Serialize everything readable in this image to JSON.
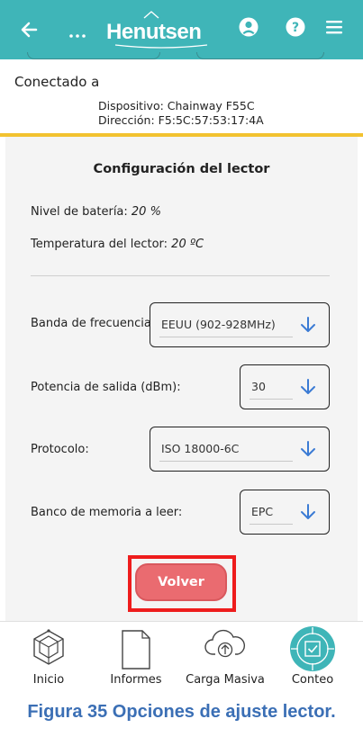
{
  "header": {
    "logo_text": "Henutsen",
    "back_icon": "arrow-left-icon",
    "more_icon": "ellipsis-icon",
    "user_icon": "user-circle-icon",
    "help_icon": "question-circle-icon",
    "menu_icon": "hamburger-menu-icon",
    "color": "#3fb5b8"
  },
  "connection": {
    "label": "Conectado a",
    "device": "Dispositivo: Chainway F55C",
    "address": "Dirección: F5:5C:57:53:17:4A",
    "accent_line_color": "#f2c230"
  },
  "reader_config": {
    "title": "Configuración del lector",
    "battery_label": "Nivel de batería: ",
    "battery_value": "20 %",
    "temperature_label": "Temperatura del lector: ",
    "temperature_value": "20 ºC",
    "fields": [
      {
        "label": "Banda de frecuencia:",
        "value": "EEUU (902-928MHz)"
      },
      {
        "label": "Potencia de salida (dBm):",
        "value": "30"
      },
      {
        "label": "Protocolo:",
        "value": "ISO 18000-6C"
      },
      {
        "label": "Banco de memoria a leer:",
        "value": "EPC"
      }
    ],
    "back_button": "Volver",
    "button_color": "#ea6b70",
    "highlight_color": "#ee1c1c",
    "dropdown_arrow_color": "#3b7bd4"
  },
  "bottom_nav": {
    "items": [
      {
        "label": "Inicio",
        "icon": "home-cube-icon"
      },
      {
        "label": "Informes",
        "icon": "document-icon"
      },
      {
        "label": "Carga Masiva",
        "icon": "cloud-upload-icon"
      },
      {
        "label": "Conteo",
        "icon": "scan-target-icon",
        "active": true
      }
    ]
  },
  "caption": "Figura 35 Opciones de ajuste lector."
}
